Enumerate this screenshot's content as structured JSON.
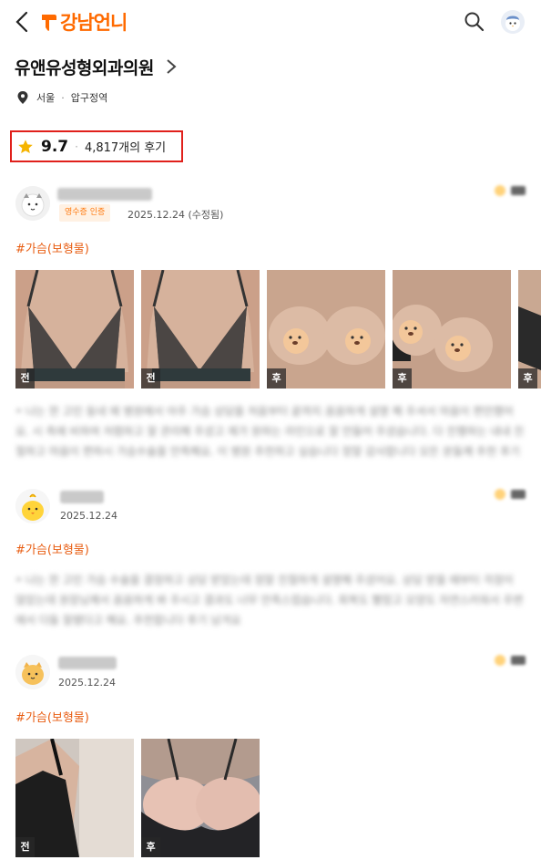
{
  "header": {
    "logo_text": "강남언니"
  },
  "clinic": {
    "name": "유앤유성형외과의원",
    "city": "서울",
    "station": "압구정역"
  },
  "rating": {
    "score": "9.7",
    "review_count": "4,817개의 후기"
  },
  "reviews": [
    {
      "badge": "영수증 인증",
      "date": "2025.12.24 (수정됨)",
      "tag": "#가슴(보형물)",
      "text": "• 나는 한 고민 동네 에 병원에서 아주 가슴 상담을 처음부터 끝까지 꼼꼼하게 설명 해 주셔서 마음이 편안했어요. 시 측에 비하여 저렴하고 잘 관리해 주셨고 제가 원하는 라인으로 잘 만들어 주셨습니다. 다 진행하는 내내 친절하고 마음이 편하시 가슴수술을 만족해요. 이 병원 추천하고 싶습니다 정말 감사합니다 모든 분들께 추천 후기 남겨요",
      "photos": [
        {
          "label": "전",
          "kind": "bra-front"
        },
        {
          "label": "전",
          "kind": "bra-front"
        },
        {
          "label": "후",
          "kind": "bear"
        },
        {
          "label": "후",
          "kind": "bear"
        },
        {
          "label": "후",
          "kind": "partial"
        }
      ]
    },
    {
      "date": "2025.12.24",
      "tag": "#가슴(보형물)",
      "text": "• 나는 한 고민 가슴 수술을 결정하고 상담 받았는데 정말 친절하게 설명해 주셨어요. 상담 받을 때부터 걱정이 많았는데 원장님께서 꼼꼼하게 봐 주시고 결과도 너무 만족스럽습니다. 회복도 빨랐고 모양도 자연스러워서 주변에서 다들 잘됐다고 해요. 추천합니다 후기 남겨요"
    },
    {
      "date": "2025.12.24",
      "tag": "#가슴(보형물)",
      "photos": [
        {
          "label": "전",
          "kind": "black-top"
        },
        {
          "label": "후",
          "kind": "black-bra"
        }
      ]
    }
  ],
  "icons": {
    "back": "back-arrow-icon",
    "search": "search-icon",
    "location": "location-pin-icon",
    "star": "star-icon",
    "chevron": "chevron-right-icon"
  },
  "colors": {
    "brand": "#ff6a00",
    "highlight_box": "#e0201b",
    "tag": "#e85d12",
    "star": "#f5b400"
  }
}
